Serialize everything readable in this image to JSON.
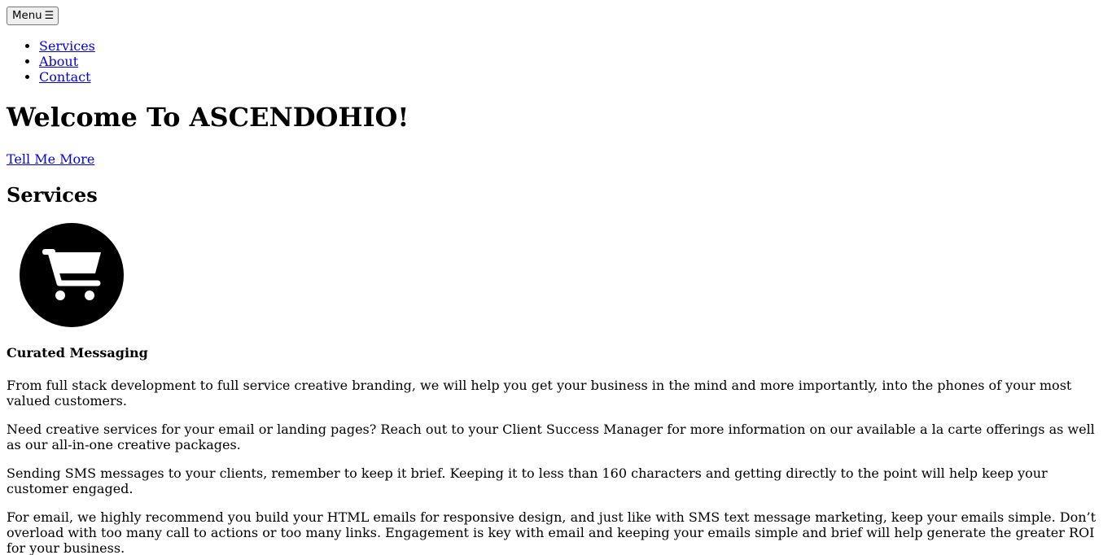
{
  "header": {
    "menu_label": "Menu",
    "menu_icon": "☰"
  },
  "nav": {
    "items": [
      {
        "label": "Services"
      },
      {
        "label": "About"
      },
      {
        "label": "Contact"
      }
    ]
  },
  "hero": {
    "title": "Welcome To ASCENDOHIO!",
    "cta_label": "Tell Me More"
  },
  "services": {
    "heading": "Services",
    "items": [
      {
        "icon": "shopping-cart-icon",
        "title": "Curated Messaging",
        "paragraphs": [
          "From full stack development to full service creative branding, we will help you get your business in the mind and more importantly, into the phones of your most valued customers.",
          "Need creative services for your email or landing pages? Reach out to your Client Success Manager for more information on our available a la carte offerings as well as our all-in-one creative packages.",
          "Sending SMS messages to your clients, remember to keep it brief. Keeping it to less than 160 characters and getting directly to the point will help keep your customer engaged.",
          "For email, we highly recommend you build your HTML emails for responsive design, and just like with SMS text message marketing, keep your emails simple. Don’t overload with too many call to actions or too many links. Engagement is key with email and keeping your emails simple and brief will help generate the greater ROI for your business."
        ]
      }
    ]
  }
}
